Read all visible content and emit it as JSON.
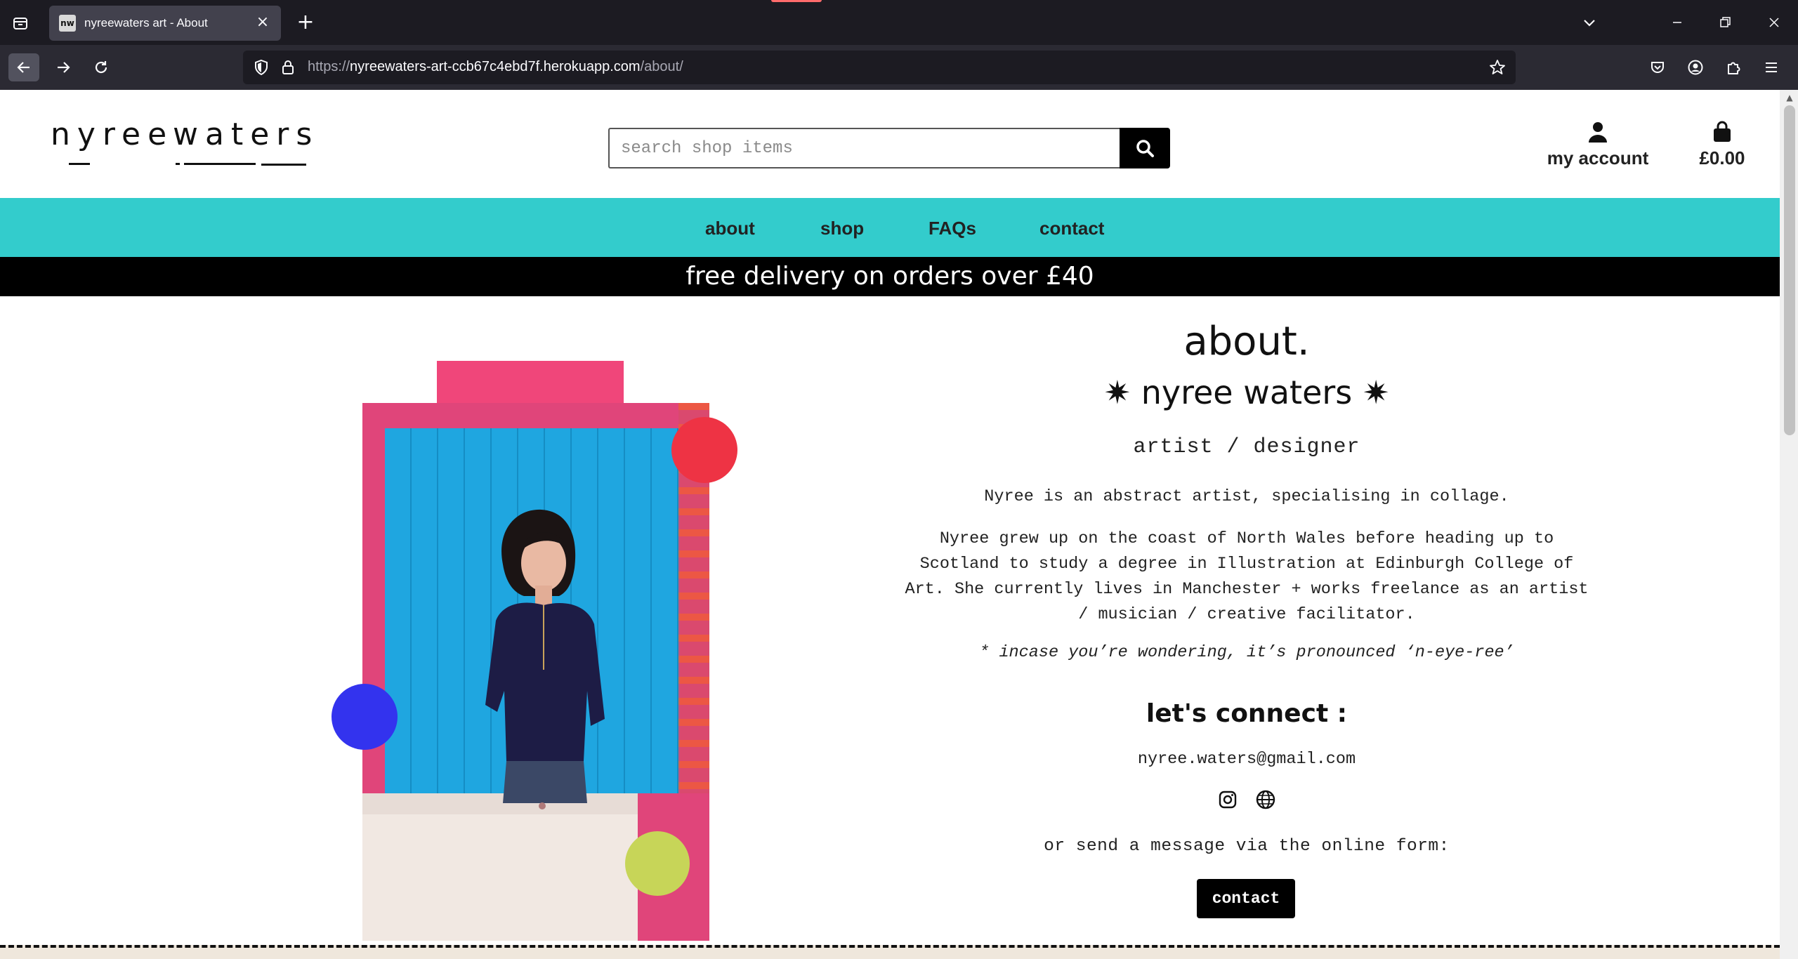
{
  "browser": {
    "tab_title": "nyreewaters art - About",
    "favicon_text": "nw",
    "url_prefix": "https://",
    "url_host": "nyreewaters-art-ccb67c4ebd7f.herokuapp.com",
    "url_path": "/about/"
  },
  "header": {
    "logo_word1": "nyree",
    "logo_word2": "waters",
    "search_placeholder": "search shop items",
    "account_label": "my account",
    "bag_total": "£0.00"
  },
  "nav": {
    "items": [
      {
        "label": "about"
      },
      {
        "label": "shop"
      },
      {
        "label": "FAQs"
      },
      {
        "label": "contact"
      }
    ]
  },
  "banner": {
    "text": "free delivery on orders over £40"
  },
  "about": {
    "title": "about.",
    "name": "✷ nyree waters ✷",
    "role": "artist / designer",
    "intro": "Nyree is an abstract artist, specialising in collage.",
    "bio": "Nyree grew up on the coast of North Wales before heading up to Scotland to study a degree in Illustration at Edinburgh College of Art. She currently lives in Manchester + works freelance as an artist / musician / creative facilitator.",
    "pronunciation": "* incase you’re wondering, it’s pronounced ‘n-eye-ree’",
    "connect_heading": "let's connect :",
    "email": "nyree.waters@gmail.com",
    "social_icons": [
      "instagram-icon",
      "globe-icon"
    ],
    "form_prompt": "or send a message via the online form:",
    "contact_button": "contact"
  },
  "colors": {
    "nav_bg": "#33cccc",
    "banner_bg": "#000000",
    "dot_red": "#ee3344",
    "dot_blue": "#3333ee",
    "dot_lime": "#c7d558",
    "tape_pink": "#f0467a"
  }
}
